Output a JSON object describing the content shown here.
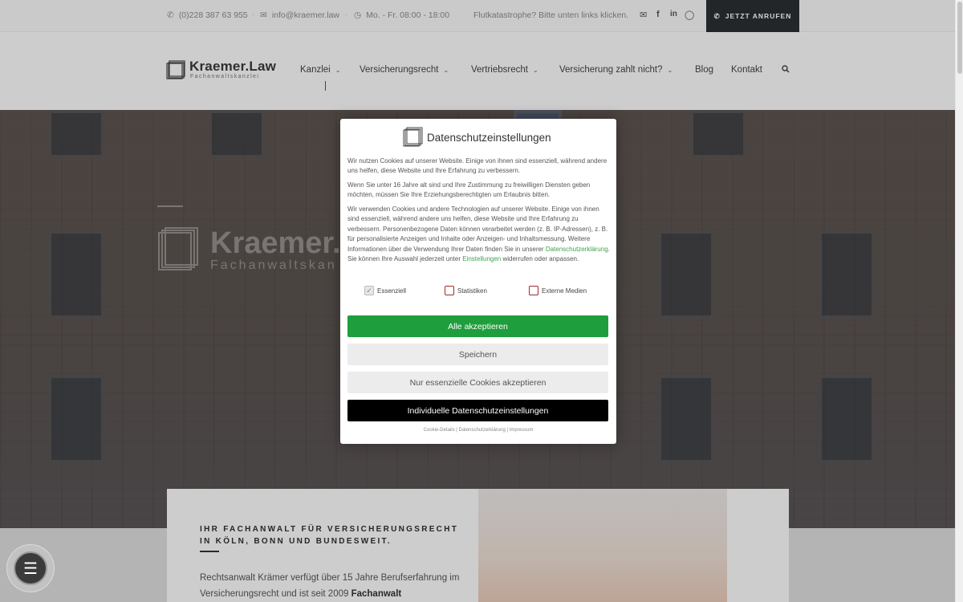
{
  "topbar": {
    "phone": "(0)228 387 63 955",
    "email": "info@kraemer.law",
    "hours": "Mo. - Fr. 08:00 - 18:00",
    "notice": "Flutkatastrophe? Bitte unten links klicken.",
    "call_button": "JETZT ANRUFEN"
  },
  "header": {
    "logo_name": "Kraemer.Law",
    "logo_sub": "Fachanwaltskanzlei",
    "nav": [
      "Kanzlei",
      "Versicherungsrecht",
      "Vertriebsrecht",
      "Versicherung zahlt nicht?",
      "Blog",
      "Kontakt"
    ]
  },
  "hero": {
    "logo_name": "Kraemer.L",
    "logo_sub": "Fachanwaltskan"
  },
  "card": {
    "title": "IHR FACHANWALT FÜR VERSICHERUNGS­RECHT IN KÖLN, BONN UND BUNDESWEIT.",
    "text_1": "Rechtsanwalt Krämer verfügt über 15 Jahre Berufserfahrung im Versicherungsrecht und ist seit 2009 ",
    "text_bold": "Fachanwalt"
  },
  "modal": {
    "title": "Datenschutzeinstellungen",
    "para1": "Wir nutzen Cookies auf unserer Website. Einige von ihnen sind essenziell, während andere uns helfen, diese Website und Ihre Erfahrung zu verbessern.",
    "para2": "Wenn Sie unter 16 Jahre alt sind und Ihre Zustimmung zu freiwilligen Diensten geben möchten, müssen Sie Ihre Erziehungsberechtigten um Erlaubnis bitten.",
    "para3_a": "Wir verwenden Cookies und andere Technologien auf unserer Website. Einige von ihnen sind essenziell, während andere uns helfen, diese Website und Ihre Erfahrung zu verbessern. Personenbezogene Daten können verarbeitet werden (z. B. IP-Adressen), z. B. für personalisierte Anzeigen und Inhalte oder Anzeigen- und Inhaltsmessung. Weitere Informationen über die Verwendung Ihrer Daten finden Sie in unserer ",
    "para3_link1": "Datenschutzerklärung",
    "para3_b": ". Sie können Ihre Auswahl jederzeit unter ",
    "para3_link2": "Einstellungen",
    "para3_c": " widerrufen oder anpassen.",
    "checkboxes": [
      {
        "label": "Essenziell",
        "checked": true
      },
      {
        "label": "Statistiken",
        "checked": false
      },
      {
        "label": "Externe Medien",
        "checked": false
      }
    ],
    "btn_accept": "Alle akzeptieren",
    "btn_save": "Speichern",
    "btn_essential": "Nur essenzielle Cookies akzeptieren",
    "btn_individual": "Individuelle Datenschutzeinstellungen",
    "footer": "Cookie-Details | Datenschutzerklärung | Impressum"
  },
  "colors": {
    "accept_green": "#1e9e3c",
    "link_green": "#3fa34d",
    "dark": "#2b2f33"
  }
}
